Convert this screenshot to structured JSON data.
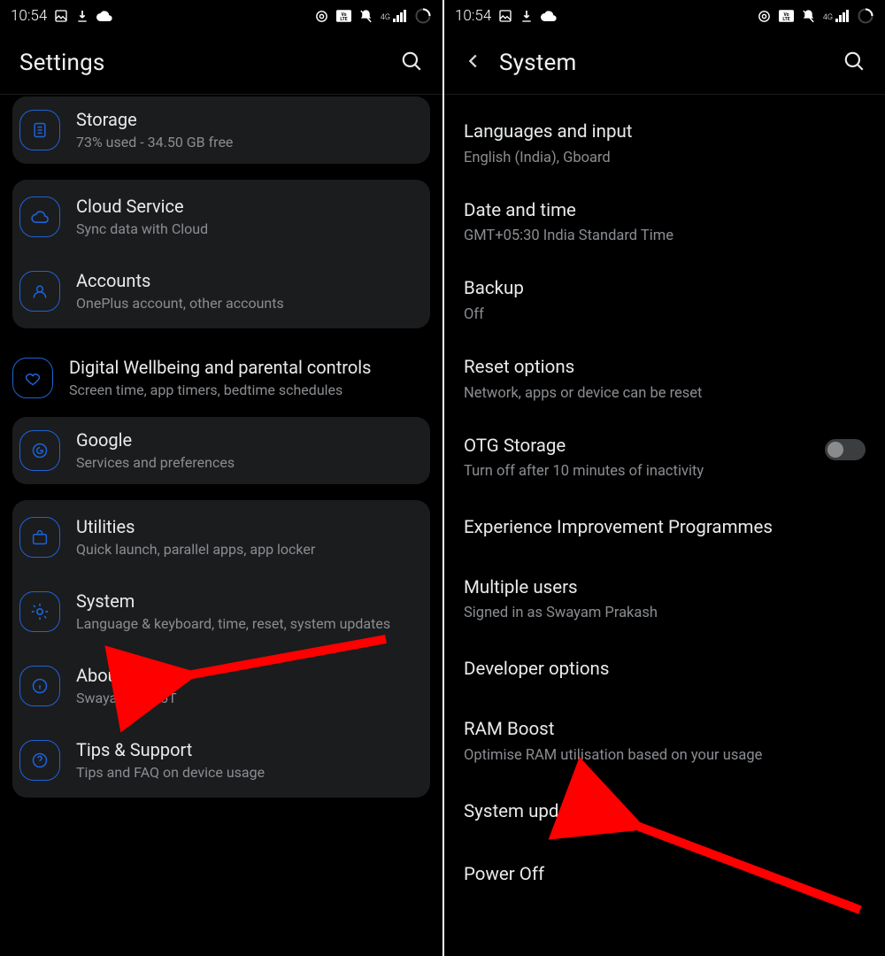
{
  "status": {
    "time": "10:54",
    "left_icons": [
      "image-icon",
      "download-icon",
      "cloud-icon"
    ],
    "right_icons": [
      "cast-icon",
      "volte-icon",
      "mute-icon",
      "signal-4g-icon",
      "spinner-icon"
    ]
  },
  "left": {
    "title": "Settings",
    "rows": {
      "storage": {
        "title": "Storage",
        "sub": "73% used - 34.50 GB free"
      },
      "cloud": {
        "title": "Cloud Service",
        "sub": "Sync data with Cloud"
      },
      "accounts": {
        "title": "Accounts",
        "sub": "OnePlus account, other accounts"
      },
      "wellbeing": {
        "title": "Digital Wellbeing and parental controls",
        "sub": "Screen time, app timers, bedtime schedules"
      },
      "google": {
        "title": "Google",
        "sub": "Services and preferences"
      },
      "utilities": {
        "title": "Utilities",
        "sub": "Quick launch, parallel apps, app locker"
      },
      "system": {
        "title": "System",
        "sub": "Language & keyboard, time, reset, system updates"
      },
      "about": {
        "title": "About phone",
        "sub": "Swayam's OP6T"
      },
      "tips": {
        "title": "Tips & Support",
        "sub": "Tips and FAQ on device usage"
      }
    }
  },
  "right": {
    "title": "System",
    "items": {
      "lang": {
        "title": "Languages and input",
        "sub": "English (India), Gboard"
      },
      "date": {
        "title": "Date and time",
        "sub": "GMT+05:30 India Standard Time"
      },
      "backup": {
        "title": "Backup",
        "sub": "Off"
      },
      "reset": {
        "title": "Reset options",
        "sub": "Network, apps or device can be reset"
      },
      "otg": {
        "title": "OTG Storage",
        "sub": "Turn off after 10 minutes of inactivity",
        "toggle": false
      },
      "exp": {
        "title": "Experience Improvement Programmes"
      },
      "users": {
        "title": "Multiple users",
        "sub": "Signed in as Swayam Prakash"
      },
      "dev": {
        "title": "Developer options"
      },
      "ram": {
        "title": "RAM Boost",
        "sub": "Optimise RAM utilisation based on your usage"
      },
      "updates": {
        "title": "System updates"
      },
      "power": {
        "title": "Power Off"
      }
    }
  }
}
